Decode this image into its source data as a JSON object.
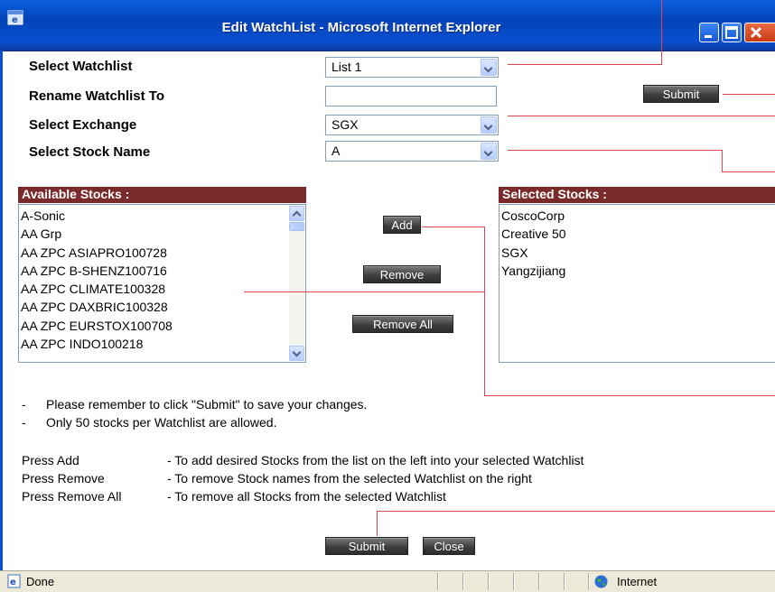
{
  "window": {
    "title": "Edit WatchList - Microsoft Internet Explorer"
  },
  "form": {
    "select_watchlist_label": "Select Watchlist",
    "select_watchlist_value": "List 1",
    "rename_label": "Rename Watchlist To",
    "rename_value": "",
    "submit_top_label": "Submit",
    "select_exchange_label": "Select Exchange",
    "select_exchange_value": "SGX",
    "select_stock_label": "Select Stock Name",
    "select_stock_value": "A"
  },
  "available": {
    "header": "Available Stocks :",
    "items": [
      "A-Sonic",
      "AA Grp",
      "AA ZPC ASIAPRO100728",
      "AA ZPC B-SHENZ100716",
      "AA ZPC CLIMATE100328",
      "AA ZPC DAXBRIC100328",
      "AA ZPC EURSTOX100708",
      "AA ZPC INDO100218"
    ]
  },
  "actions": {
    "add": "Add",
    "remove": "Remove",
    "remove_all": "Remove All"
  },
  "selected": {
    "header": "Selected Stocks :",
    "items": [
      "CoscoCorp",
      "Creative 50",
      "SGX",
      "Yangzijiang"
    ]
  },
  "notes": {
    "dash": "-",
    "n1": "Please remember to click \"Submit\" to save your changes.",
    "n2": "Only 50 stocks per Watchlist are allowed."
  },
  "help": [
    {
      "key": "Press Add",
      "text": "- To add desired Stocks from the list on the left into your selected Watchlist"
    },
    {
      "key": "Press Remove",
      "text": "- To remove Stock names from the selected Watchlist on the right"
    },
    {
      "key": "Press Remove All",
      "text": "- To remove all Stocks from the selected Watchlist"
    }
  ],
  "bottom": {
    "submit": "Submit",
    "close": "Close"
  },
  "statusbar": {
    "status": "Done",
    "zone": "Internet"
  },
  "colors": {
    "panel_header": "#7a2a2a",
    "annotation_line": "#e0474c",
    "titlebar": "#0a4fd1"
  }
}
